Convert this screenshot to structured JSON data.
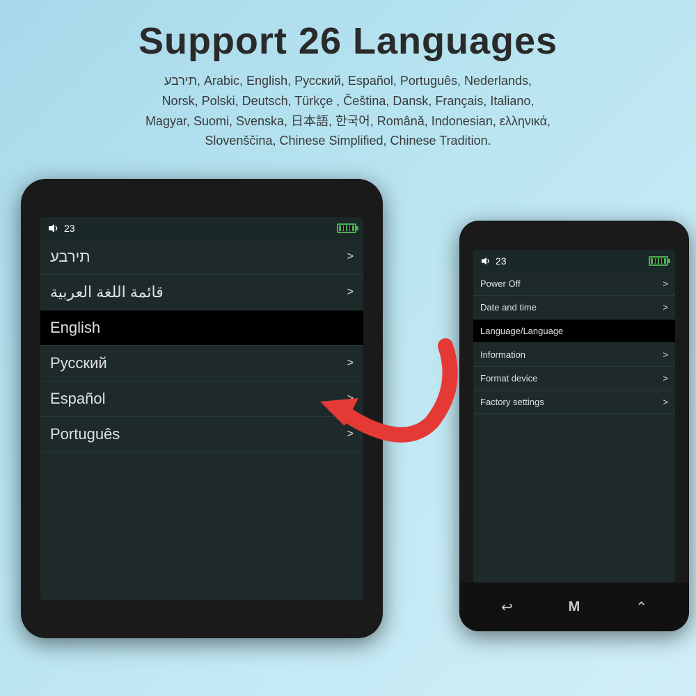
{
  "header": {
    "title": "Support 26 Languages",
    "subtitle": "תירבע, Arabic, English, Русский, Español, Português, Nederlands,\nNorsk, Polski, Deutsch, Türkçe , Čeština, Dansk, Français, Italiano,\nMagyar, Suomi, Svenska, 日本語, 한국어, Română, Indonesian, ελληνικά,\nSlovenščina, Chinese Simplified, Chinese Tradition."
  },
  "left_device": {
    "status": {
      "volume": "23",
      "battery_label": "battery-full"
    },
    "menu_items": [
      {
        "label": "תירבע",
        "active": false,
        "has_chevron": true
      },
      {
        "label": "قائمة اللغة العربية",
        "active": false,
        "has_chevron": true
      },
      {
        "label": "English",
        "active": true,
        "has_chevron": false
      },
      {
        "label": "Русский",
        "active": false,
        "has_chevron": true
      },
      {
        "label": "Español",
        "active": false,
        "has_chevron": true
      },
      {
        "label": "Português",
        "active": false,
        "has_chevron": true
      }
    ]
  },
  "right_device": {
    "status": {
      "volume": "23",
      "battery_label": "battery-full"
    },
    "menu_items": [
      {
        "label": "Power Off",
        "active": false,
        "has_chevron": true
      },
      {
        "label": "Date and time",
        "active": false,
        "has_chevron": true
      },
      {
        "label": "Language/Language",
        "active": true,
        "has_chevron": false
      },
      {
        "label": "Information",
        "active": false,
        "has_chevron": true
      },
      {
        "label": "Format device",
        "active": false,
        "has_chevron": true
      },
      {
        "label": "Factory settings",
        "active": false,
        "has_chevron": true
      }
    ],
    "nav": {
      "back_icon": "↩",
      "menu_icon": "M",
      "up_icon": "⌃"
    }
  }
}
